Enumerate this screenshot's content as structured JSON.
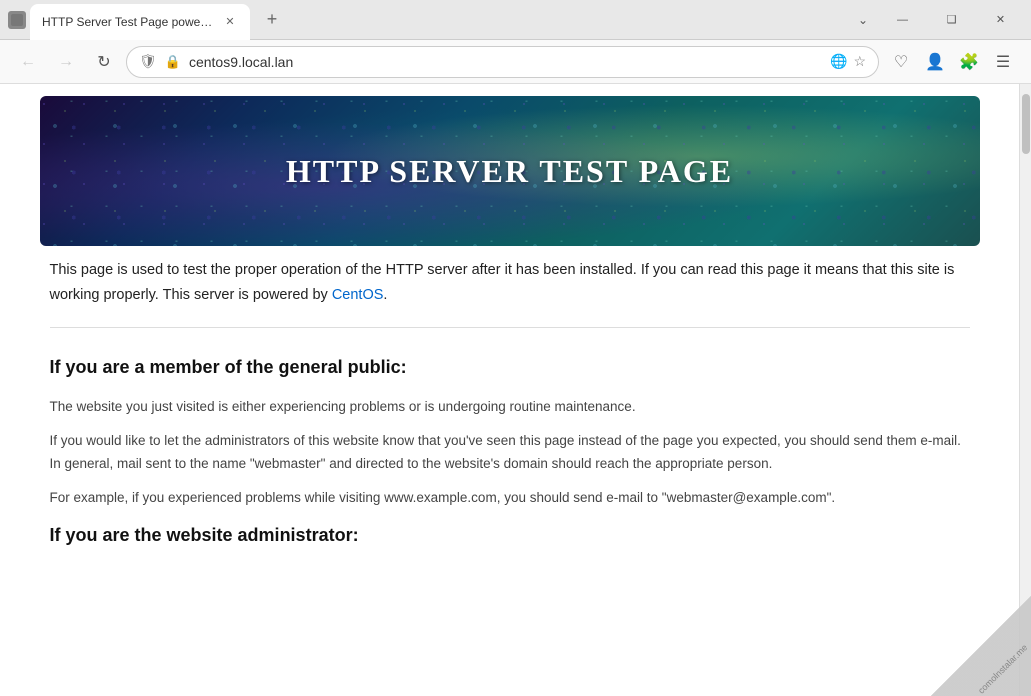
{
  "browser": {
    "tab_title": "HTTP Server Test Page powered by",
    "url": "centos9.local.lan",
    "new_tab_label": "+"
  },
  "window_controls": {
    "minimize": "—",
    "restore": "❑",
    "close": "✕",
    "chevron": "⌄"
  },
  "nav": {
    "back": "←",
    "forward": "→",
    "refresh": "↻"
  },
  "hero": {
    "title": "HTTP SERVER TEST PAGE"
  },
  "intro": {
    "text1": "This page is used to test the proper operation of the HTTP server after it has been installed. If you can read this page it means that this site is working properly. This server is powered by ",
    "link_text": "CentOS",
    "text2": "."
  },
  "section1": {
    "heading": "If you are a member of the general public:",
    "para1": "The website you just visited is either experiencing problems or is undergoing routine maintenance.",
    "para2": "If you would like to let the administrators of this website know that you've seen this page instead of the page you expected, you should send them e-mail. In general, mail sent to the name \"webmaster\" and directed to the website's domain should reach the appropriate person.",
    "para3": "For example, if you experienced problems while visiting www.example.com, you should send e-mail to \"webmaster@example.com\"."
  },
  "section2": {
    "heading": "If you are the website administrator:"
  },
  "watermark": {
    "text": "comolnstalar.me"
  }
}
